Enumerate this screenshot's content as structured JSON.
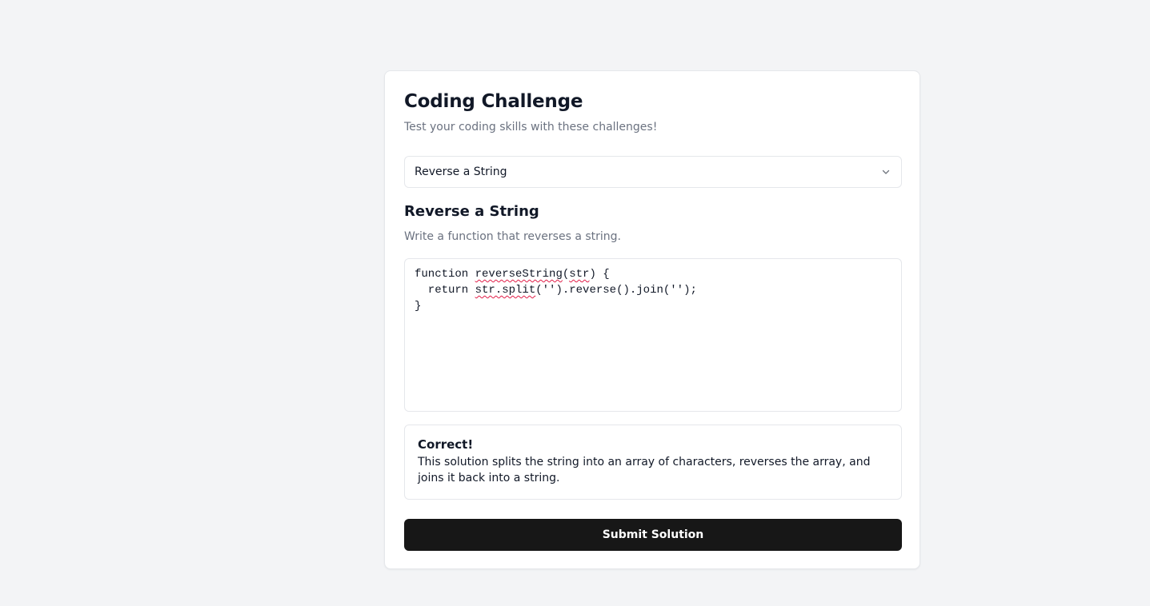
{
  "header": {
    "title": "Coding Challenge",
    "subtitle": "Test your coding skills with these challenges!"
  },
  "challenge_select": {
    "selected": "Reverse a String",
    "icon": "chevron-down-icon"
  },
  "challenge": {
    "title": "Reverse a String",
    "description": "Write a function that reverses a string."
  },
  "editor": {
    "line1_pre": "function ",
    "line1_fn": "reverseString",
    "line1_mid": "(",
    "line1_arg": "str",
    "line1_post": ") {",
    "line2_pre": "  return ",
    "line2_call": "str.split",
    "line2_post": "('').reverse().join('');",
    "line3": "}"
  },
  "result": {
    "title": "Correct!",
    "message": "This solution splits the string into an array of characters, reverses the array, and joins it back into a string."
  },
  "actions": {
    "submit_label": "Submit Solution"
  },
  "colors": {
    "background": "#f3f4f6",
    "card": "#ffffff",
    "button": "#171717",
    "muted_text": "#6b7280"
  }
}
